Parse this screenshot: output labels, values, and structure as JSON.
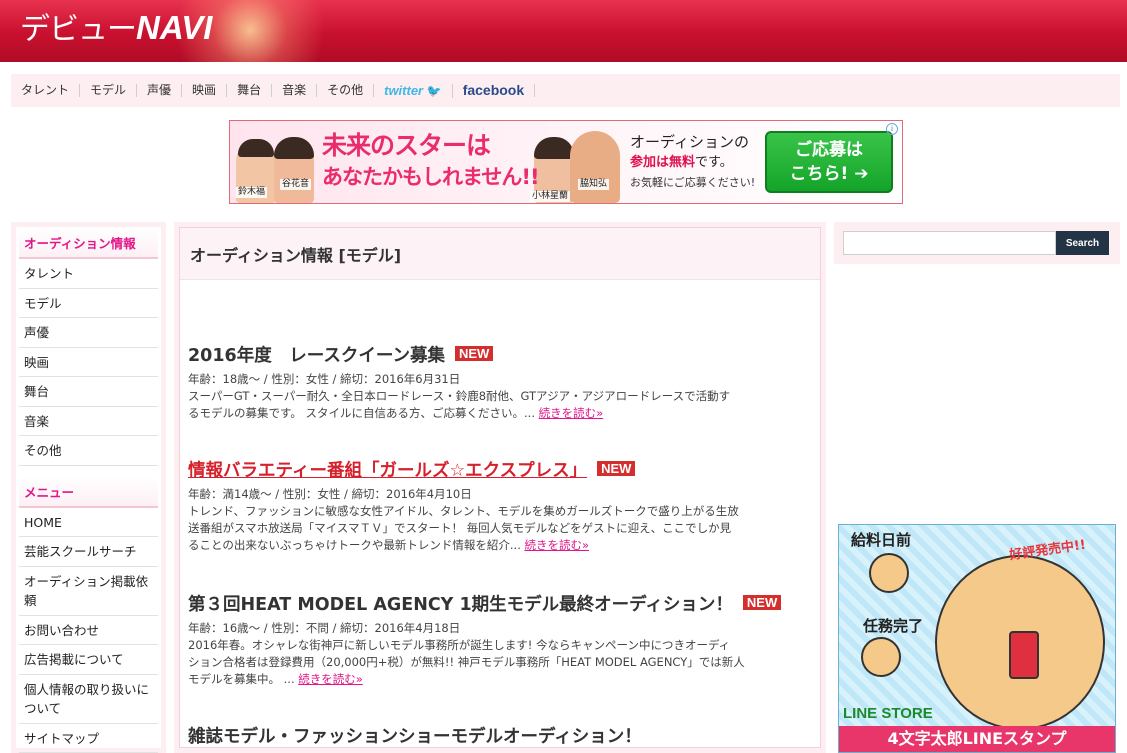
{
  "header": {
    "logo_a": "デビュー",
    "logo_b": "NAVI"
  },
  "nav": {
    "items": [
      "タレント",
      "モデル",
      "声優",
      "映画",
      "舞台",
      "音楽",
      "その他"
    ],
    "twitter": "twitter",
    "facebook": "facebook"
  },
  "banner": {
    "main_1": "未来のスターは",
    "main_2": "あなたかもしれません!!",
    "right_1": "オーディションの",
    "right_2a": "参加は無料",
    "right_2b": "です。",
    "right_3": "お気軽にご応募ください!",
    "button_1": "ご応募は",
    "button_2": "こちら! ➔",
    "names": [
      "鈴木福",
      "谷花音",
      "小林星蘭",
      "脇知弘"
    ]
  },
  "sidebar": {
    "section1_title": "オーディション情報",
    "section1_items": [
      "タレント",
      "モデル",
      "声優",
      "映画",
      "舞台",
      "音楽",
      "その他"
    ],
    "section2_title": "メニュー",
    "section2_items": [
      "HOME",
      "芸能スクールサーチ",
      "オーディション掲載依頼",
      "お問い合わせ",
      "広告掲載について",
      "個人情報の取り扱いについて",
      "サイトマップ"
    ]
  },
  "main": {
    "heading": "オーディション情報 [モデル]",
    "new_label": "NEW",
    "more_label": "続きを読む»",
    "articles": [
      {
        "title": "2016年度　レースクイーン募集",
        "meta": "年齢：18歳〜 / 性別：女性 / 締切：2016年6月31日",
        "desc1": "スーパーGT・スーパー耐久・全日本ロードレース・鈴鹿8耐他、GTアジア・アジアロードレースで活動す",
        "desc2": "るモデルの募集です。 スタイルに自信ある方、ご応募ください。..."
      },
      {
        "title": "情報バラエティー番組「ガールズ☆エクスプレス」",
        "meta": "年齢：満14歳〜 / 性別：女性 / 締切：2016年4月10日",
        "desc1": "トレンド、ファッションに敏感な女性アイドル、タレント、モデルを集めガールズトークで盛り上がる生放",
        "desc2": "送番組がスマホ放送局「マイスマＴＶ」でスタート！ 毎回人気モデルなどをゲストに迎え、ここでしか見",
        "desc3": "ることの出来ないぶっちゃけトークや最新トレンド情報を紹介..."
      },
      {
        "title": "第３回HEAT MODEL AGENCY 1期生モデル最終オーディション！",
        "meta": "年齢：16歳〜 / 性別：不問 / 締切：2016年4月18日",
        "desc1": "2016年春。オシャレな街神戸に新しいモデル事務所が誕生します! 今ならキャンペーン中につきオーディ",
        "desc2": "ション合格者は登録費用（20,000円+税）が無料!! 神戸モデル事務所「HEAT MODEL AGENCY」では新人",
        "desc3": "モデルを募集中。 ..."
      },
      {
        "title": "雑誌モデル・ファッションショーモデルオーディション！"
      }
    ]
  },
  "right": {
    "search_button": "Search",
    "ad_top": "給料日前",
    "ad_badge": "好評発売中!!",
    "ad_mid": "任務完了",
    "ad_store": "LINE STORE",
    "ad_bottom": "4文字太郎LINEスタンプ"
  }
}
